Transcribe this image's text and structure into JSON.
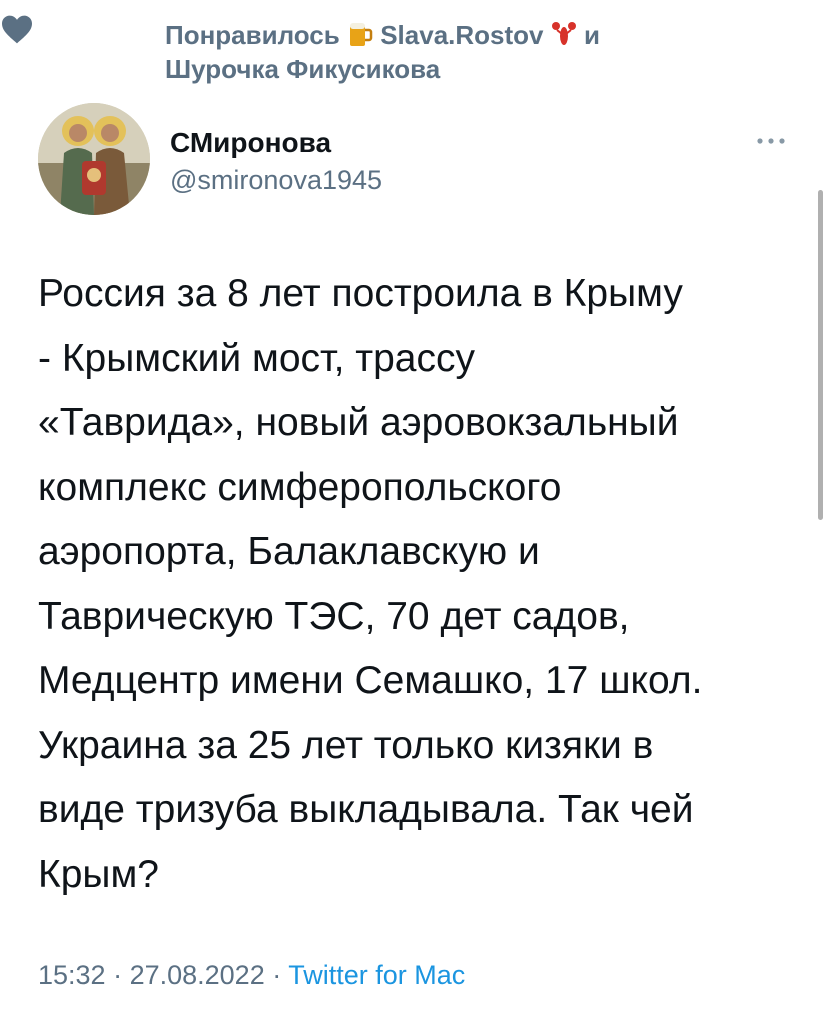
{
  "liked": {
    "prefix": "Понравилось",
    "user1": "Slava.Rostov",
    "conjunction": "и",
    "user2": "Шурочка Фикусикова",
    "icon": "heart-icon",
    "emoji1": "beer-mug-icon",
    "emoji2": "lobster-icon"
  },
  "author": {
    "name": "СМиронова",
    "handle": "@smironova1945"
  },
  "tweet": {
    "text": "Россия за 8 лет построила в Крыму\n- Крымский мост, трассу\n«Таврида», новый аэровокзальный\nкомплекс симферопольского\nаэропорта, Балаклавскую и\nТаврическую ТЭС, 70 дет садов,\nМедцентр имени Семашко, 17 школ.\nУкраина за 25 лет только кизяки в\nвиде тризуба выкладывала. Так чей\nКрым?"
  },
  "meta": {
    "time": "15:32",
    "sep1": " · ",
    "date": "27.08.2022",
    "sep2": " · ",
    "source": "Twitter for Mac"
  },
  "colors": {
    "secondary_text": "#5b7083",
    "link": "#1b95e0",
    "heart": "#5b7083"
  }
}
